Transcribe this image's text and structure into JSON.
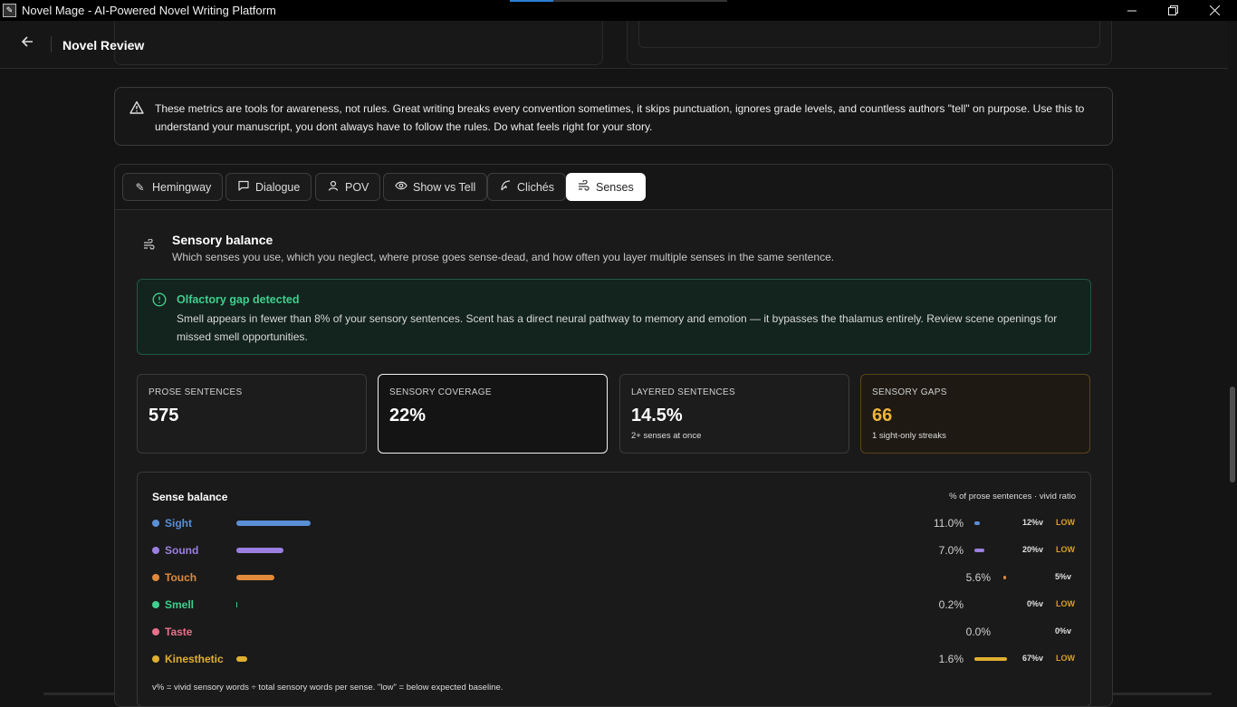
{
  "window": {
    "title": "Novel Mage - AI-Powered Novel Writing Platform",
    "icon_name": "app-logo-icon",
    "controls": [
      "minimize-icon",
      "restore-icon",
      "close-icon"
    ]
  },
  "header": {
    "back_icon": "arrow-left-icon",
    "title": "Novel Review"
  },
  "notice": {
    "icon": "alert-triangle-icon",
    "text": "These metrics are tools for awareness, not rules. Great writing breaks every convention sometimes, it skips punctuation, ignores grade levels, and countless authors \"tell\" on purpose. Use this to understand your manuscript, you dont always have to follow the rules. Do what feels right for your story."
  },
  "tabs": [
    {
      "label": "Hemingway",
      "icon": "pencil-icon",
      "active": false
    },
    {
      "label": "Dialogue",
      "icon": "speech-bubble-icon",
      "active": false
    },
    {
      "label": "POV",
      "icon": "user-icon",
      "active": false
    },
    {
      "label": "Show vs Tell",
      "icon": "eye-icon",
      "active": false
    },
    {
      "label": "Clichés",
      "icon": "feather-icon",
      "active": false
    },
    {
      "label": "Senses",
      "icon": "wind-icon",
      "active": true
    }
  ],
  "section": {
    "icon": "wind-icon",
    "title": "Sensory balance",
    "description": "Which senses you use, which you neglect, where prose goes sense-dead, and how often you layer multiple senses in the same sentence."
  },
  "alert": {
    "icon": "info-circle-icon",
    "title": "Olfactory gap detected",
    "body": "Smell appears in fewer than 8% of your sensory sentences. Scent has a direct neural pathway to memory and emotion — it bypasses the thalamus entirely. Review scene openings for missed smell opportunities."
  },
  "stats": [
    {
      "label": "PROSE SENTENCES",
      "value": "575",
      "sub": ""
    },
    {
      "label": "SENSORY COVERAGE",
      "value": "22%",
      "sub": ""
    },
    {
      "label": "LAYERED SENTENCES",
      "value": "14.5%",
      "sub": "2+ senses at once"
    },
    {
      "label": "SENSORY GAPS",
      "value": "66",
      "sub": "1 sight-only streaks"
    }
  ],
  "balance": {
    "heading": "Sense balance",
    "legend": "% of prose sentences · vivid ratio",
    "footnote": "v% = vivid sensory words ÷ total sensory words per sense. \"low\" = below expected baseline.",
    "senses": [
      {
        "name": "Sight",
        "color": "#5b8fd6",
        "percent": 11.0,
        "percent_label": "11.0%",
        "vivid": 0.12,
        "vivid_label": "12%v",
        "flag": "LOW"
      },
      {
        "name": "Sound",
        "color": "#9b7fe0",
        "percent": 7.0,
        "percent_label": "7.0%",
        "vivid": 0.2,
        "vivid_label": "20%v",
        "flag": "LOW"
      },
      {
        "name": "Touch",
        "color": "#e08a3c",
        "percent": 5.6,
        "percent_label": "5.6%",
        "vivid": 0.05,
        "vivid_label": "5%v",
        "flag": ""
      },
      {
        "name": "Smell",
        "color": "#3fcf8e",
        "percent": 0.2,
        "percent_label": "0.2%",
        "vivid": 0.0,
        "vivid_label": "0%v",
        "flag": "LOW"
      },
      {
        "name": "Taste",
        "color": "#e8708a",
        "percent": 0.0,
        "percent_label": "0.0%",
        "vivid": 0.0,
        "vivid_label": "0%v",
        "flag": ""
      },
      {
        "name": "Kinesthetic",
        "color": "#e0b030",
        "percent": 1.6,
        "percent_label": "1.6%",
        "vivid": 0.67,
        "vivid_label": "67%v",
        "flag": "LOW"
      }
    ],
    "colors": {
      "flag_low": "#d9a020"
    }
  }
}
